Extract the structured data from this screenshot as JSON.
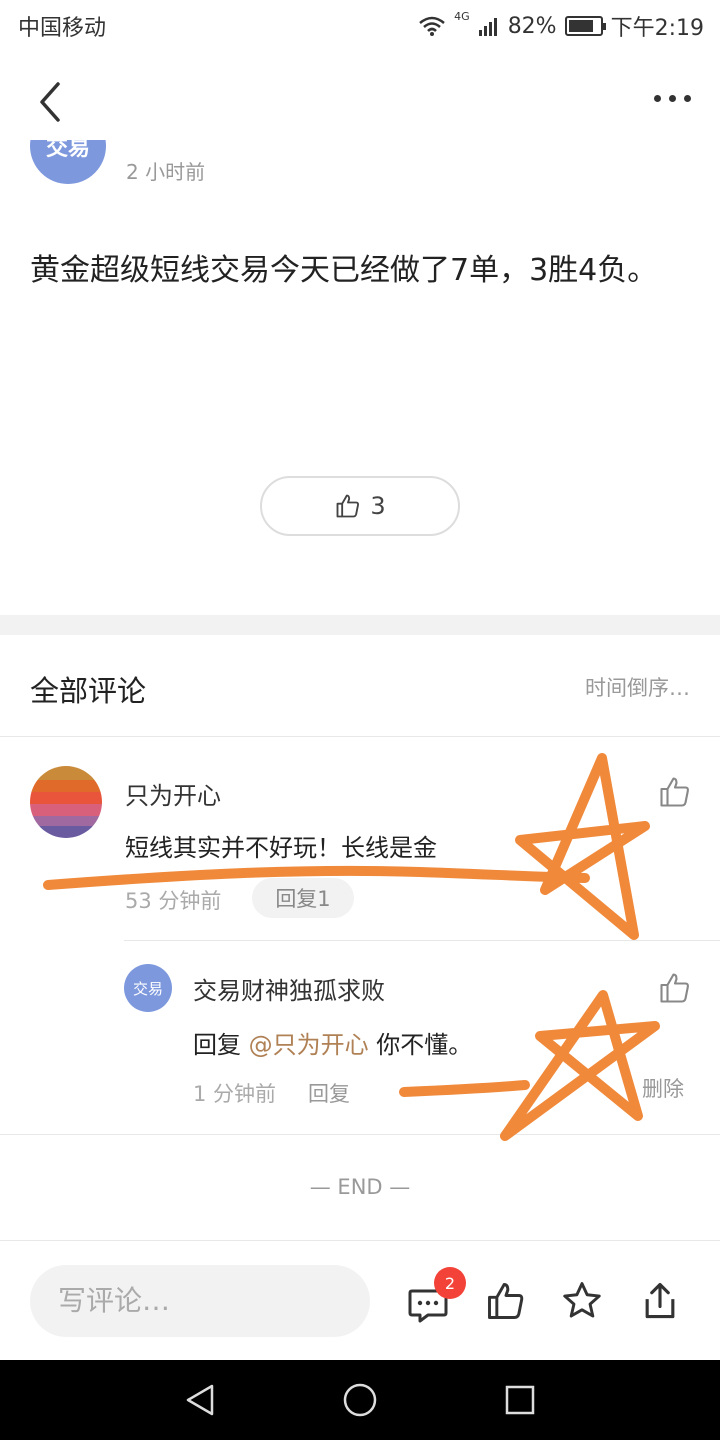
{
  "status_bar": {
    "carrier": "中国移动",
    "network": "4G",
    "battery": "82%",
    "battery_level": 0.82,
    "time": "下午2:19"
  },
  "post": {
    "author_avatar_text": "交易",
    "time": "2 小时前",
    "body": "黄金超级短线交易今天已经做了7单，3胜4负。",
    "like_count": "3"
  },
  "comments_section": {
    "title": "全部评论",
    "sort_label": "时间倒序…",
    "comments": [
      {
        "author": "只为开心",
        "text": "短线其实并不好玩！长线是金",
        "time": "53 分钟前",
        "reply_label": "回复1",
        "replies": [
          {
            "avatar_text": "交易",
            "author": "交易财神独孤求败",
            "reply_prefix": "回复",
            "mention": "@只为开心",
            "text": "你不懂。",
            "time": "1 分钟前",
            "reply_label": "回复",
            "delete_label": "删除"
          }
        ]
      }
    ],
    "end_text": "— END —"
  },
  "bottom_bar": {
    "input_placeholder": "写评论…",
    "comment_badge": "2"
  },
  "colors": {
    "annotation": "#f0893a",
    "avatar_blue": "#7d98dd",
    "mention": "#b08155",
    "badge": "#f34338"
  }
}
